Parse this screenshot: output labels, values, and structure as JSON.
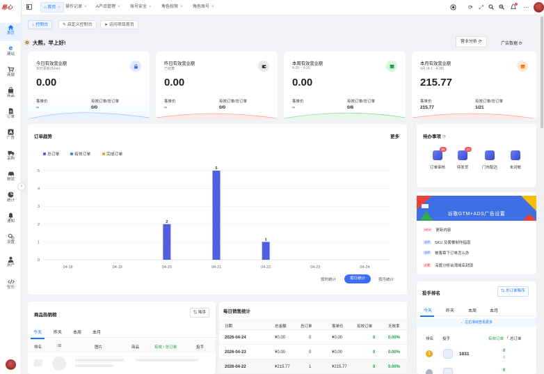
{
  "brand": {
    "logo_text": "易心"
  },
  "sidebar": {
    "items": [
      {
        "label": "首页",
        "icon": "home-icon"
      },
      {
        "label": "建站",
        "icon": "browser-icon"
      },
      {
        "label": "商城",
        "icon": "cart-icon"
      },
      {
        "label": "商品",
        "icon": "bag-icon"
      },
      {
        "label": "订单",
        "icon": "order-icon"
      },
      {
        "label": "广告",
        "icon": "ad-icon"
      },
      {
        "label": "采购",
        "icon": "truck-icon"
      },
      {
        "label": "物流",
        "icon": "car-icon"
      },
      {
        "label": "统计",
        "icon": "pie-icon"
      },
      {
        "label": "通知",
        "icon": "bell-icon"
      },
      {
        "label": "设置",
        "icon": "gear-icon"
      },
      {
        "label": "用户",
        "icon": "user-icon"
      },
      {
        "label": "安乐",
        "icon": "code-icon"
      }
    ]
  },
  "topbar": {
    "tabs": [
      "首页",
      "操作记录",
      "A产品管理",
      "账号安全",
      "角色权限",
      "角色账号"
    ]
  },
  "subtabs": [
    "控制台",
    "自定义控制台",
    "访问项目首页"
  ],
  "dashboard": {
    "greeting": "大熊，早上好!",
    "btn_analysis": "营业分析",
    "btn_ads": "广告数据"
  },
  "stats": [
    {
      "title": "今日有效营业额",
      "sub": "实时更新(5min)",
      "value": "0.00",
      "lbl1": "客单价",
      "lbl2": "有效订单/总订单",
      "num1": "--",
      "num2": "0/0"
    },
    {
      "title": "昨日有效营业额",
      "sub": "已结算",
      "value": "0.00",
      "lbl1": "客单价",
      "lbl2": "有效订单/总订单",
      "num1": "--",
      "num2": "0/0"
    },
    {
      "title": "本周有效营业额",
      "sub": "4-20 ~ 4-26",
      "value": "0.00",
      "lbl1": "客单价",
      "lbl2": "有效订单/总订单",
      "num1": "--",
      "num2": "0/8"
    },
    {
      "title": "本月有效营业额",
      "sub": "4月 (4-1 - 4-30)",
      "value": "215.77",
      "lbl1": "客单价",
      "lbl2": "有效订单/总订单",
      "num1": "215.77",
      "num2": "1/21"
    }
  ],
  "order_trend": {
    "title": "订单趋势",
    "more": "更多",
    "legend": [
      "总订单",
      "有效订单",
      "完成订单"
    ],
    "modes": [
      "按时统计",
      "按日统计",
      "按月统计"
    ]
  },
  "chart_data": {
    "type": "bar",
    "categories": [
      "04-18",
      "04-19",
      "04-20",
      "04-21",
      "04-22",
      "04-23",
      "04-24"
    ],
    "series": [
      {
        "name": "总订单",
        "values": [
          0,
          0,
          2,
          5,
          1,
          0,
          0
        ]
      },
      {
        "name": "有效订单",
        "values": [
          0,
          0,
          0,
          0,
          0,
          0,
          0
        ]
      },
      {
        "name": "完成订单",
        "values": [
          0,
          0,
          0,
          0,
          0,
          0,
          0
        ]
      }
    ],
    "yticks": [
      0,
      1,
      2,
      3,
      4,
      5
    ],
    "ylim": [
      0,
      5
    ],
    "data_labels": [
      "",
      "",
      "2",
      "5",
      "1",
      "",
      ""
    ],
    "colors": [
      "#4f5fe0",
      "#2f89ff",
      "#f2a01d"
    ]
  },
  "todo": {
    "title": "待办事项",
    "items": [
      {
        "label": "订单审核",
        "badge": "66"
      },
      {
        "label": "待发货",
        "badge": "22"
      },
      {
        "label": "门市配达",
        "badge": ""
      },
      {
        "label": "未对帐",
        "badge": ""
      }
    ]
  },
  "banner": {
    "text": "谷歌GTM+ADS广告设置"
  },
  "news": [
    {
      "tag": "NEW",
      "text": "更新内容"
    },
    {
      "tag": "说明",
      "text": "SKU 及套餐制作指南"
    },
    {
      "tag": "说明",
      "text": "被客章下订单怎么办"
    },
    {
      "tag": "必看",
      "text": "深度分析台湾域名封锁"
    }
  ],
  "hot": {
    "title": "商品热销榜",
    "sort_btn": "降序",
    "tabs": [
      "今天",
      "昨天",
      "本周",
      "本月"
    ],
    "cols": [
      "排名",
      "ID",
      "图片",
      "商品",
      "有效 / 总订单",
      "投手"
    ]
  },
  "daily": {
    "title": "每日销售统计",
    "cols": [
      "日期",
      "总金额",
      "总订单",
      "客单价",
      "有效订单",
      "无效率"
    ],
    "rows": [
      [
        "2026-04-24",
        "¥0.00",
        "0",
        "¥0.00",
        "0",
        "0.00%"
      ],
      [
        "2026-04-23",
        "¥0.00",
        "0",
        "¥0.00",
        "0",
        "0.00%"
      ],
      [
        "2026-04-22",
        "¥215.77",
        "1",
        "¥215.77",
        "0",
        "0.00%"
      ]
    ]
  },
  "pitcher": {
    "title": "投手排名",
    "sort_btn": "总订单降序",
    "tabs": [
      "今天",
      "昨天",
      "本周",
      "本月"
    ],
    "scroll_hint": "← 左右滑动查看更多",
    "cols": [
      "排名",
      "投手",
      "有效订单",
      "总订单"
    ],
    "rows": [
      {
        "name": "1031",
        "v1": "0",
        "v2": "0"
      },
      {
        "name": "",
        "v1": "0",
        "v2": ""
      }
    ]
  }
}
